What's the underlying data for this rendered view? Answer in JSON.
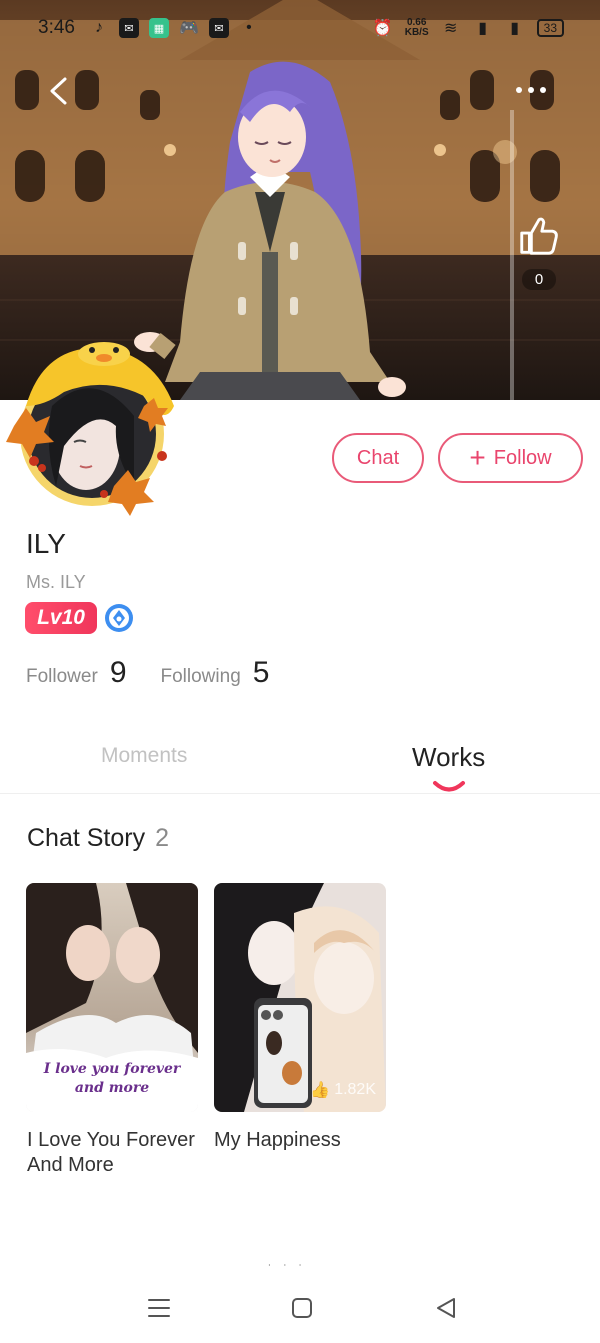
{
  "status_bar": {
    "time": "3:46",
    "network_speed_value": "0.66",
    "network_speed_unit": "KB/S",
    "battery": "33"
  },
  "banner": {
    "like_count": "0"
  },
  "profile": {
    "name": "ILY",
    "username": "Ms. ILY",
    "level": "Lv10",
    "follower_label": "Follower",
    "follower_count": "9",
    "following_label": "Following",
    "following_count": "5"
  },
  "actions": {
    "chat_label": "Chat",
    "follow_label": "Follow"
  },
  "tabs": [
    {
      "label": "Moments",
      "active": false
    },
    {
      "label": "Works",
      "active": true
    }
  ],
  "section": {
    "title": "Chat Story",
    "count": "2"
  },
  "stories": [
    {
      "title": "I Love You Forever And More",
      "cover_text_line1": "I love you forever",
      "cover_text_line2": "and more"
    },
    {
      "title": "My Happiness",
      "likes": "1.82K"
    }
  ],
  "colors": {
    "accent": "#e9456d",
    "level_badge": "#f0365b",
    "muted_text": "#8a8a8a"
  }
}
